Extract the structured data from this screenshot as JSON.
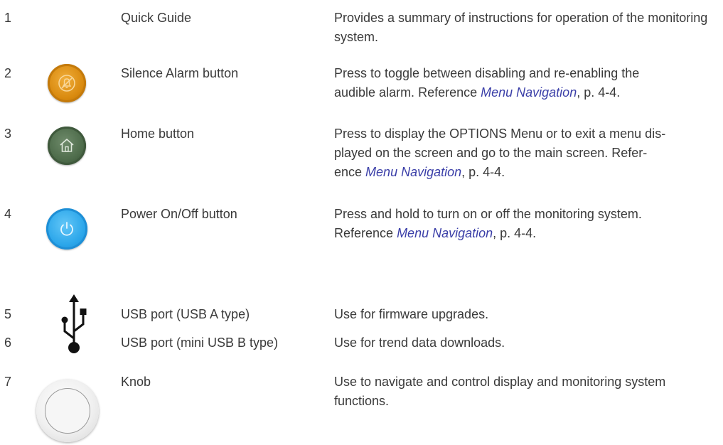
{
  "rows": [
    {
      "number": "1",
      "name": "Quick Guide",
      "desc_text": "Provides a summary of instructions for operation of the monitoring system."
    },
    {
      "number": "2",
      "name": "Silence Alarm button",
      "desc_line1": "Press to toggle between disabling and re-enabling the",
      "desc_line2_pre": "audible alarm. Reference ",
      "desc_link": "Menu Navigation",
      "desc_post": ", p. 4-4.",
      "icon": "silence-alarm-icon",
      "icon_color": "#e0950f"
    },
    {
      "number": "3",
      "name": "Home button",
      "desc_line1": "Press to display the OPTIONS Menu or to exit a menu dis-",
      "desc_line2": "played on the screen and go to the main screen. Refer-",
      "desc_line3_pre": "ence ",
      "desc_link": "Menu Navigation",
      "desc_post": ", p. 4-4.",
      "icon": "home-icon",
      "icon_color": "#4f6e4c"
    },
    {
      "number": "4",
      "name": "Power On/Off button",
      "desc_line1": "Press and hold to turn on or off the monitoring system.",
      "desc_line2_pre": "Reference ",
      "desc_link": "Menu Navigation",
      "desc_post": ", p. 4-4.",
      "icon": "power-icon",
      "icon_color": "#2ba6ea"
    },
    {
      "number": "5",
      "name": "USB port (USB A type)",
      "desc_text": "Use for firmware upgrades.",
      "icon": "usb-icon"
    },
    {
      "number": "6",
      "name": "USB port (mini USB B type)",
      "desc_text": "Use for trend data downloads."
    },
    {
      "number": "7",
      "name": "Knob",
      "desc_text": "Use to navigate and control display and monitoring system functions.",
      "icon": "knob-icon"
    }
  ],
  "colors": {
    "text": "#3a3a3a",
    "link": "#3b3fa8"
  }
}
